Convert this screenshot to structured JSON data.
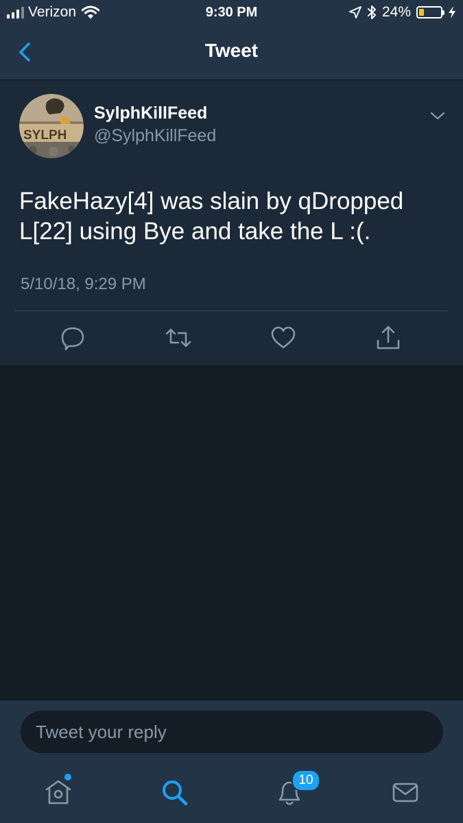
{
  "status_bar": {
    "carrier": "Verizon",
    "time": "9:30 PM",
    "battery_percent_label": "24%",
    "battery_level": 0.24
  },
  "nav": {
    "title": "Tweet",
    "back_icon": "chevron-left-icon"
  },
  "tweet": {
    "display_name": "SylphKillFeed",
    "handle": "@SylphKillFeed",
    "text": "FakeHazy[4] was slain by qDropped L[22] using Bye and take the L :(.",
    "timestamp": "5/10/18, 9:29 PM",
    "actions": [
      "reply-icon",
      "retweet-icon",
      "like-icon",
      "share-icon"
    ]
  },
  "reply": {
    "placeholder": "Tweet your reply"
  },
  "tab_bar": {
    "tabs": [
      "home-icon",
      "search-icon",
      "notifications-icon",
      "messages-icon"
    ],
    "notifications_badge": "10"
  },
  "colors": {
    "accent": "#1da1f2",
    "background": "#141d26",
    "card": "#1c2938",
    "bar": "#243447",
    "secondary_text": "#8899a6",
    "battery": "#f5c518"
  }
}
